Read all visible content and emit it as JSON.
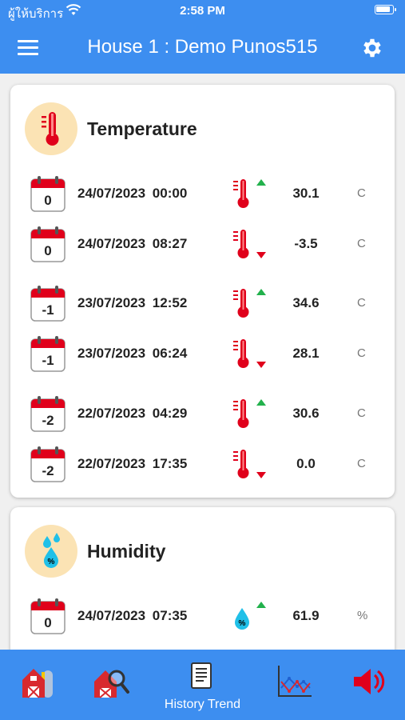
{
  "status_bar": {
    "carrier": "ผู้ให้บริการ",
    "time": "2:58 PM"
  },
  "app_bar": {
    "title": "House 1 : Demo Punos515",
    "menu_icon": "menu-icon",
    "settings_icon": "gear-icon"
  },
  "temperature": {
    "title": "Temperature",
    "rows": [
      {
        "day": "0",
        "date": "24/07/2023 00:00",
        "trend": "up",
        "value": "30.1",
        "unit": "C"
      },
      {
        "day": "0",
        "date": "24/07/2023 08:27",
        "trend": "down",
        "value": "-3.5",
        "unit": "C"
      },
      {
        "day": "-1",
        "date": "23/07/2023 12:52",
        "trend": "up",
        "value": "34.6",
        "unit": "C"
      },
      {
        "day": "-1",
        "date": "23/07/2023 06:24",
        "trend": "down",
        "value": "28.1",
        "unit": "C"
      },
      {
        "day": "-2",
        "date": "22/07/2023 04:29",
        "trend": "up",
        "value": "30.6",
        "unit": "C"
      },
      {
        "day": "-2",
        "date": "22/07/2023 17:35",
        "trend": "down",
        "value": "0.0",
        "unit": "C"
      }
    ]
  },
  "humidity": {
    "title": "Humidity",
    "rows": [
      {
        "day": "0",
        "date": "24/07/2023 07:35",
        "trend": "up",
        "value": "61.9",
        "unit": "%"
      }
    ]
  },
  "bottom_bar": {
    "active_label": "History Trend"
  },
  "colors": {
    "primary": "#3d8ef0",
    "up": "#22b14c",
    "down": "#e0001b",
    "thermometer": "#e0001b",
    "drop": "#20c0e8"
  }
}
